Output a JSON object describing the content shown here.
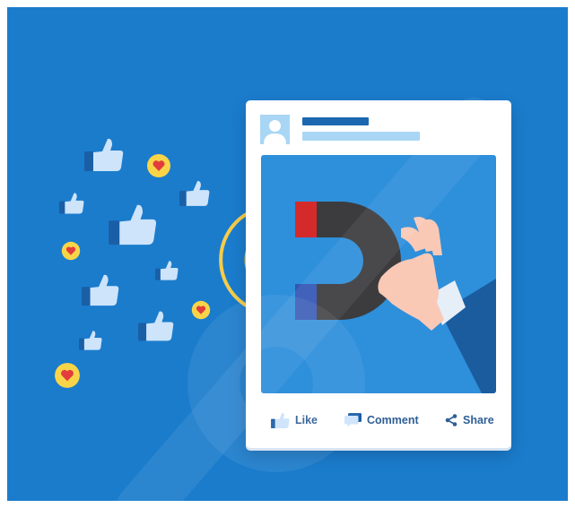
{
  "colors": {
    "background": "#1b7ccc",
    "card": "#ffffff",
    "image_panel": "#2e8fdb",
    "accent_dark": "#1b67b0",
    "accent_light": "#a9d6f5",
    "thumbs": "#cde4fb",
    "cuff": "#1a5fa6",
    "heart_badge": "#f8d548",
    "heart": "#e23d3d",
    "signal_arcs": "#f5cc4a",
    "magnet_body": "#3c3c3e",
    "magnet_red_pole": "#d52a2a",
    "magnet_blue_pole": "#3355b5",
    "skin": "#f9c9b6",
    "sleeve": "#1b5c9e",
    "shirt_cuff": "#e6eef8"
  },
  "icons": {
    "avatar": "user-avatar-icon",
    "like": "thumbs-up-icon",
    "comment": "speech-bubble-icon",
    "share": "share-nodes-icon",
    "magnet": "magnet-icon",
    "hand": "hand-icon"
  },
  "post": {
    "actions": {
      "like_label": "Like",
      "comment_label": "Comment",
      "share_label": "Share"
    }
  }
}
